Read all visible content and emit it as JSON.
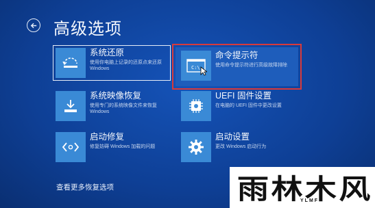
{
  "header": {
    "title": "高级选项"
  },
  "options": [
    {
      "id": "system-restore",
      "title": "系统还原",
      "desc": "使用你电脑上记录的还原点来还原 Windows",
      "icon": "restore-icon"
    },
    {
      "id": "command-prompt",
      "title": "命令提示符",
      "desc": "使用命令提示符进行高级故障排除",
      "icon": "command-prompt-icon"
    },
    {
      "id": "system-image-recovery",
      "title": "系统映像恢复",
      "desc": "使用专门的系统映像文件来恢复 Windows",
      "icon": "image-recovery-icon"
    },
    {
      "id": "uefi-settings",
      "title": "UEFI 固件设置",
      "desc": "在电脑的 UEFI 固件中更改设置",
      "icon": "chip-icon"
    },
    {
      "id": "startup-repair",
      "title": "启动修复",
      "desc": "修复妨碍 Windows 加载的问题",
      "icon": "code-icon"
    },
    {
      "id": "startup-settings",
      "title": "启动设置",
      "desc": "更改 Windows 启动行为",
      "icon": "gear-icon"
    }
  ],
  "footer": {
    "more_label": "查看更多恢复选项"
  },
  "watermark": {
    "text": "雨林木风",
    "sub": "YLMF"
  },
  "colors": {
    "background": "#1553b8",
    "tile": "#3a8ad6",
    "highlight": "#d93a3a"
  }
}
